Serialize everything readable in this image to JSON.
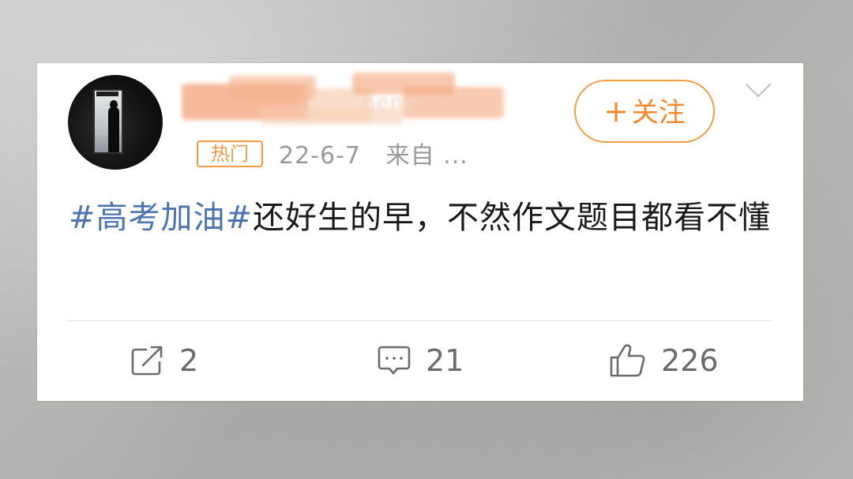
{
  "post": {
    "username": "nene",
    "hot_badge": "热门",
    "time": "22-6-7",
    "source_prefix": "来自 ...",
    "follow_label": "关注",
    "follow_plus": "+",
    "hashtag": "#高考加油#",
    "text": "还好生的早，不然作文题目都看不懂"
  },
  "actions": {
    "repost_count": "2",
    "comment_count": "21",
    "like_count": "226"
  },
  "colors": {
    "accent_orange": "#f3882d",
    "hashtag_blue": "#4c74b0",
    "card_background": "#ffffff"
  },
  "icons": {
    "repost": "share-square-icon",
    "comment": "comment-bubble-icon",
    "like": "thumbs-up-icon",
    "more": "chevron-down-icon"
  }
}
